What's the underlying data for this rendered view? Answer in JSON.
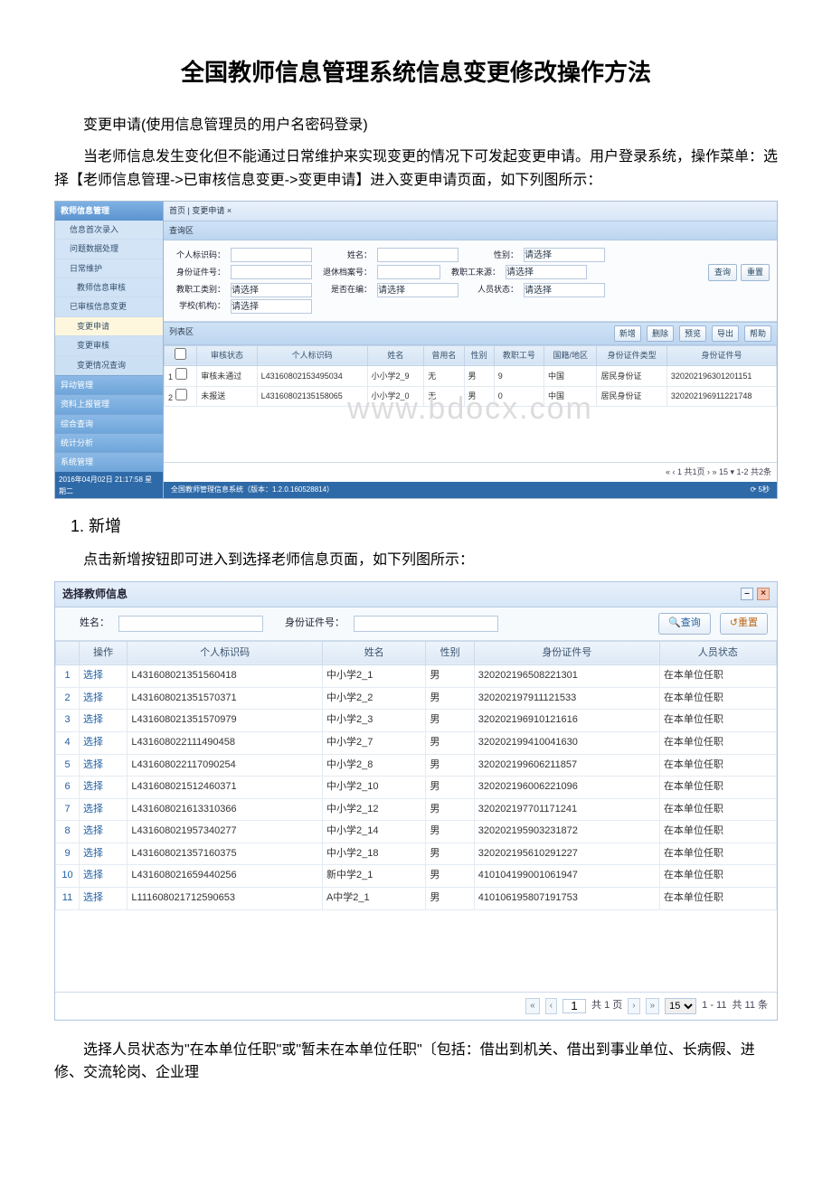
{
  "title": "全国教师信息管理系统信息变更修改操作方法",
  "para1": "变更申请(使用信息管理员的用户名密码登录)",
  "para2": "当老师信息发生变化但不能通过日常维护来实现变更的情况下可发起变更申请。用户登录系统，操作菜单：选择【老师信息管理->已审核信息变更->变更申请】进入变更申请页面，如下列图所示：",
  "section1": "1. 新增",
  "para3": "点击新增按钮即可进入到选择老师信息页面，如下列图所示：",
  "para4": "选择人员状态为\"在本单位任职\"或\"暂未在本单位任职\"〔包括：借出到机关、借出到事业单位、长病假、进修、交流轮岗、企业理",
  "shot1": {
    "sidebar": {
      "head": "教师信息管理",
      "items": [
        {
          "label": "信息首次录入",
          "sub": false
        },
        {
          "label": "问题数据处理",
          "sub": false
        },
        {
          "label": "日常维护",
          "sub": false
        },
        {
          "label": "教师信息审核",
          "sub": true
        },
        {
          "label": "已审核信息变更",
          "sub": false
        },
        {
          "label": "变更申请",
          "sub": true,
          "active": true
        },
        {
          "label": "变更审核",
          "sub": true
        },
        {
          "label": "变更情况查询",
          "sub": true
        }
      ],
      "groups": [
        "异动管理",
        "资料上报管理",
        "综合查询",
        "统计分析",
        "系统管理"
      ],
      "footer": "2016年04月02日 21:17:58 星期二"
    },
    "tabbar": "首页 | 变更申请 ×",
    "panel_query": "查询区",
    "query": {
      "l_code": "个人标识码：",
      "l_name": "姓名：",
      "l_sex": "性别：",
      "ph_sex": "请选择",
      "l_idno": "身份证件号：",
      "l_retire": "退休档案号：",
      "l_source": "教职工来源：",
      "ph_source": "请选择",
      "l_type": "教职工类别：",
      "ph_type": "请选择",
      "l_hr": "是否在编：",
      "ph_hr": "请选择",
      "l_status": "人员状态：",
      "ph_status": "请选择",
      "l_org": "学校(机构)：",
      "ph_org": "请选择",
      "btn_query": "查询",
      "btn_reset": "重置"
    },
    "panel_list": "列表区",
    "toolbar": {
      "add": "新增",
      "del": "删除",
      "report": "预览",
      "export": "导出",
      "help": "帮助"
    },
    "grid": {
      "headers": [
        "",
        "审核状态",
        "个人标识码",
        "姓名",
        "曾用名",
        "性别",
        "教职工号",
        "国籍/地区",
        "身份证件类型",
        "身份证件号"
      ],
      "rows": [
        {
          "n": "1",
          "status": "审核未通过",
          "code": "L43160802153495034",
          "name": "小小学2_9",
          "former": "无",
          "sex": "男",
          "empno": "9",
          "nation": "中国",
          "idtype": "居民身份证",
          "idno": "320202196301201151"
        },
        {
          "n": "2",
          "status": "未报送",
          "code": "L43160802135158065",
          "name": "小小学2_0",
          "former": "无",
          "sex": "男",
          "empno": "0",
          "nation": "中国",
          "idtype": "居民身份证",
          "idno": "320202196911221748"
        }
      ]
    },
    "watermark": "www.bdocx.com",
    "pager": "« ‹ 1 共1页 › » 15 ▾ 1-2 共2条",
    "footer_main": "全国教师管理信息系统（版本：1.2.0.160528814）",
    "footer_right": "⟳ 5秒"
  },
  "shot2": {
    "title": "选择教师信息",
    "search": {
      "l_name": "姓名：",
      "l_idno": "身份证件号：",
      "btn_query": "查询",
      "btn_reset": "重置"
    },
    "headers": [
      "",
      "操作",
      "个人标识码",
      "姓名",
      "性别",
      "身份证件号",
      "人员状态"
    ],
    "op": "选择",
    "rows": [
      {
        "n": "1",
        "code": "L431608021351560418",
        "name": "中小学2_1",
        "sex": "男",
        "id": "320202196508221301",
        "status": "在本单位任职"
      },
      {
        "n": "2",
        "code": "L431608021351570371",
        "name": "中小学2_2",
        "sex": "男",
        "id": "320202197911121533",
        "status": "在本单位任职"
      },
      {
        "n": "3",
        "code": "L431608021351570979",
        "name": "中小学2_3",
        "sex": "男",
        "id": "320202196910121616",
        "status": "在本单位任职"
      },
      {
        "n": "4",
        "code": "L431608022111490458",
        "name": "中小学2_7",
        "sex": "男",
        "id": "320202199410041630",
        "status": "在本单位任职"
      },
      {
        "n": "5",
        "code": "L431608022117090254",
        "name": "中小学2_8",
        "sex": "男",
        "id": "320202199606211857",
        "status": "在本单位任职"
      },
      {
        "n": "6",
        "code": "L431608021512460371",
        "name": "中小学2_10",
        "sex": "男",
        "id": "320202196006221096",
        "status": "在本单位任职"
      },
      {
        "n": "7",
        "code": "L431608021613310366",
        "name": "中小学2_12",
        "sex": "男",
        "id": "320202197701171241",
        "status": "在本单位任职"
      },
      {
        "n": "8",
        "code": "L431608021957340277",
        "name": "中小学2_14",
        "sex": "男",
        "id": "320202195903231872",
        "status": "在本单位任职"
      },
      {
        "n": "9",
        "code": "L431608021357160375",
        "name": "中小学2_18",
        "sex": "男",
        "id": "320202195610291227",
        "status": "在本单位任职"
      },
      {
        "n": "10",
        "code": "L431608021659440256",
        "name": "新中学2_1",
        "sex": "男",
        "id": "410104199001061947",
        "status": "在本单位任职"
      },
      {
        "n": "11",
        "code": "L111608021712590653",
        "name": "A中学2_1",
        "sex": "男",
        "id": "410106195807191753",
        "status": "在本单位任职"
      }
    ],
    "pager": {
      "page": "1",
      "total_pages": "共 1 页",
      "size": "15",
      "range": "1 - 11",
      "total": "共 11 条"
    }
  }
}
